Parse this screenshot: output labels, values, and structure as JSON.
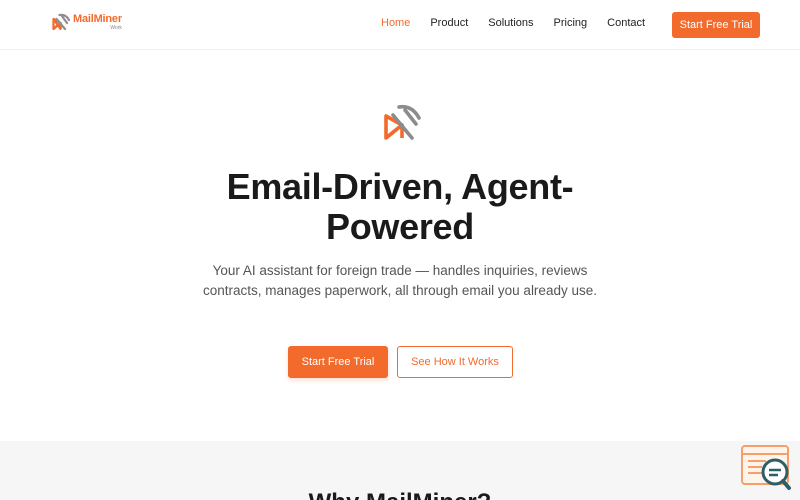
{
  "brand": {
    "name": "MailMiner",
    "sub": "Work",
    "accent_color": "#f26b2c",
    "logo_icon": "pickaxe-envelope-icon"
  },
  "nav": {
    "items": [
      {
        "label": "Home",
        "active": true
      },
      {
        "label": "Product",
        "active": false
      },
      {
        "label": "Solutions",
        "active": false
      },
      {
        "label": "Pricing",
        "active": false
      },
      {
        "label": "Contact",
        "active": false
      }
    ],
    "cta_label": "Start Free Trial"
  },
  "hero": {
    "icon": "pickaxe-envelope-icon",
    "title_line1": "Email-Driven, Agent-",
    "title_line2": "Powered",
    "subtitle": "Your AI assistant for foreign trade — handles inquiries, reviews contracts, manages paperwork, all through email you already use.",
    "primary_button": "Start Free Trial",
    "secondary_button": "See How It Works"
  },
  "section2": {
    "title": "Why MailMiner?"
  },
  "widget": {
    "icon": "search-chat-icon"
  }
}
